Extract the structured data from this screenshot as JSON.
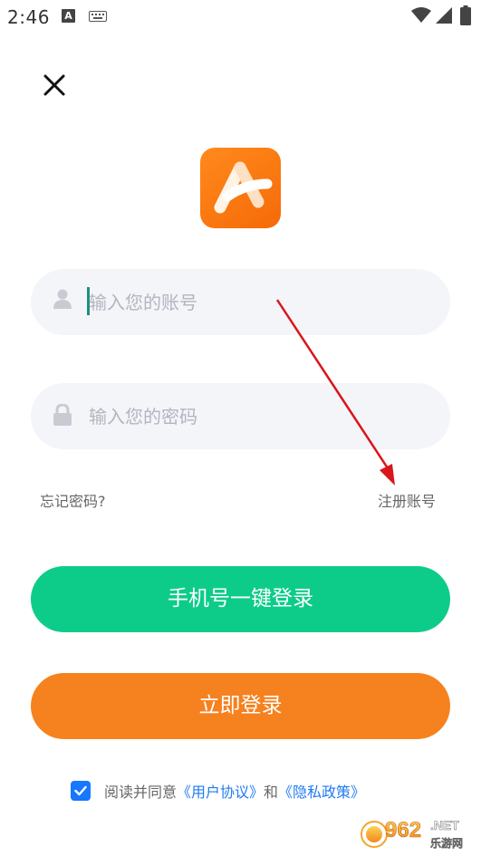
{
  "status_bar": {
    "time": "2:46",
    "notification_letter": "A"
  },
  "login": {
    "account_placeholder": "输入您的账号",
    "password_placeholder": "输入您的密码",
    "forgot_password": "忘记密码?",
    "register": "注册账号",
    "phone_login_button": "手机号一键登录",
    "login_button": "立即登录"
  },
  "agreement": {
    "checked": true,
    "prefix": "阅读并同意",
    "user_agreement": "《用户协议》",
    "conjunction": "和",
    "privacy_policy": "《隐私政策》"
  },
  "watermark": {
    "number": "962",
    "suffix": ".NET",
    "subtitle": "乐游网"
  },
  "icons": {
    "close": "close-icon",
    "account": "user-icon",
    "password": "lock-icon",
    "checkbox": "checkmark-icon",
    "wifi": "wifi-icon",
    "signal": "signal-icon",
    "battery": "battery-icon",
    "keyboard": "keyboard-icon",
    "app_logo": "app-logo-icon"
  },
  "colors": {
    "phone_login_bg": "#0dcc8a",
    "login_bg": "#f6811f",
    "link_blue": "#1f7bf2",
    "checkbox_blue": "#1677ff",
    "input_bg": "#f4f5f9",
    "annotation_arrow": "#d8161b"
  }
}
